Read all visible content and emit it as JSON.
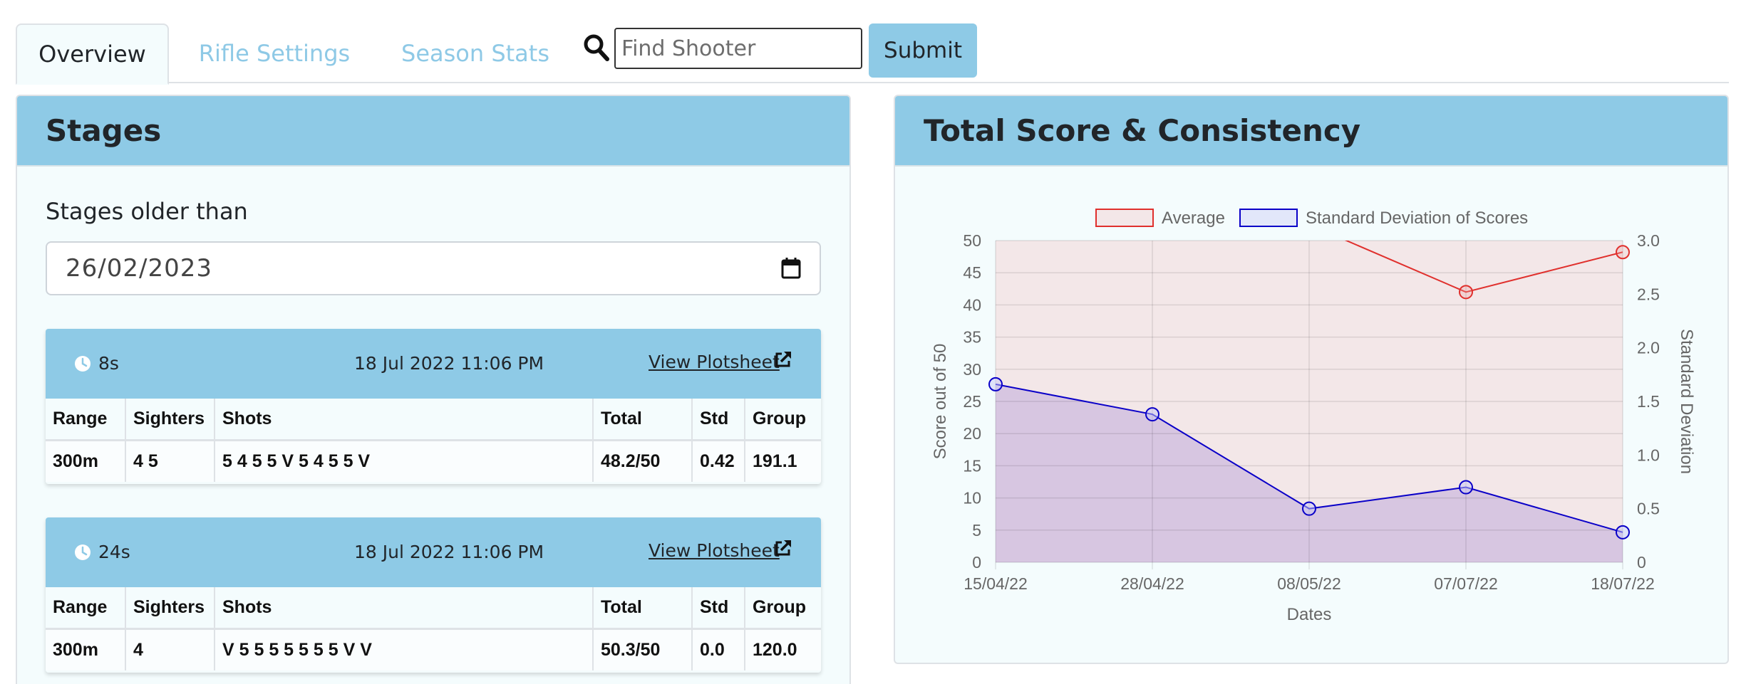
{
  "nav": {
    "tabs": [
      {
        "label": "Overview",
        "active": true
      },
      {
        "label": "Rifle Settings",
        "active": false
      },
      {
        "label": "Season Stats",
        "active": false
      }
    ],
    "search_placeholder": "Find Shooter",
    "search_value": "",
    "submit_label": "Submit",
    "search_icon": "search-icon"
  },
  "stages_panel": {
    "title": "Stages",
    "filter_label": "Stages older than",
    "filter_date": "26/02/2023",
    "stages": [
      {
        "duration": "8s",
        "datetime": "18 Jul 2022 11:06 PM",
        "link_label": "View Plotsheet",
        "headers": [
          "Range",
          "Sighters",
          "Shots",
          "Total",
          "Std",
          "Group"
        ],
        "row": [
          "300m",
          "4 5",
          "5 4 5 5 V 5 4 5 5 V",
          "48.2/50",
          "0.42",
          "191.1"
        ]
      },
      {
        "duration": "24s",
        "datetime": "18 Jul 2022 11:06 PM",
        "link_label": "View Plotsheet",
        "headers": [
          "Range",
          "Sighters",
          "Shots",
          "Total",
          "Std",
          "Group"
        ],
        "row": [
          "300m",
          "4",
          "V 5 5 5 5 5 5 5 V V",
          "50.3/50",
          "0.0",
          "120.0"
        ]
      }
    ]
  },
  "chart_panel": {
    "title": "Total Score & Consistency"
  },
  "chart_data": {
    "type": "line",
    "x": [
      "15/04/22",
      "28/04/22",
      "08/05/22",
      "07/07/22",
      "18/07/22"
    ],
    "xlabel": "Dates",
    "ylabel": "Score out of 50",
    "y2label": "Standard Deviation",
    "ylim": [
      0,
      50
    ],
    "y2lim": [
      0,
      3.0
    ],
    "yticks": [
      0,
      5,
      10,
      15,
      20,
      25,
      30,
      35,
      40,
      45,
      50
    ],
    "y2ticks": [
      "0",
      "0.5",
      "1.0",
      "1.5",
      "2.0",
      "2.5",
      "3.0"
    ],
    "grid": true,
    "legend": "top",
    "series": [
      {
        "name": "Average",
        "axis": "left",
        "color": "#e0302d",
        "fill": "rgba(240,160,160,0.22)",
        "values": [
          null,
          null,
          null,
          42,
          48.2
        ],
        "offscale_start": 52.5
      },
      {
        "name": "Standard Deviation of Scores",
        "axis": "right",
        "color": "#0a00c8",
        "fill": "rgba(120,80,200,0.22)",
        "values": [
          1.66,
          1.38,
          0.5,
          0.7,
          0.28
        ]
      }
    ]
  }
}
